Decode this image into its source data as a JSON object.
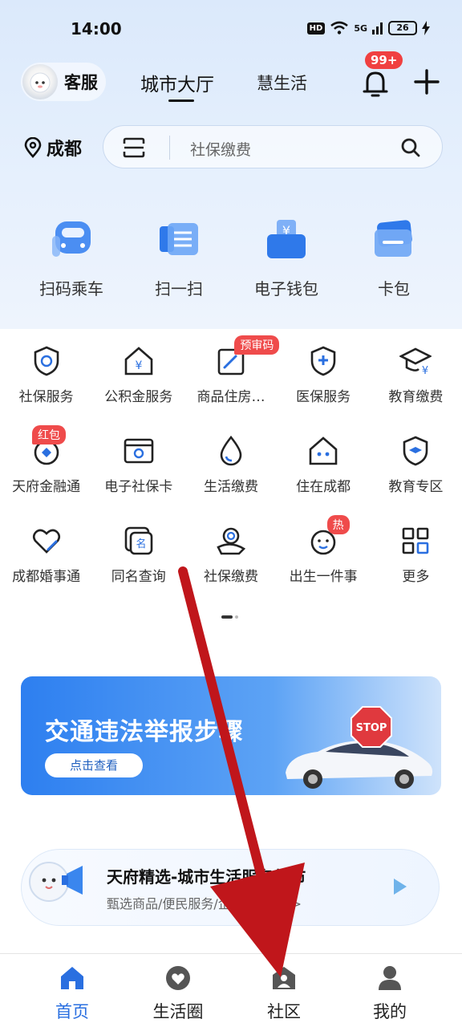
{
  "status_bar": {
    "time": "14:00",
    "hd": "HD",
    "network": "5G",
    "battery": "26"
  },
  "header": {
    "service_label": "客服",
    "tabs": [
      {
        "label": "城市大厅"
      },
      {
        "label": "慧生活"
      }
    ],
    "notification_badge": "99+"
  },
  "location": {
    "city": "成都"
  },
  "search": {
    "placeholder": "社保缴费"
  },
  "quick_actions": [
    {
      "label": "扫码乘车",
      "icon": "bus-qr-icon"
    },
    {
      "label": "扫一扫",
      "icon": "scan-icon"
    },
    {
      "label": "电子钱包",
      "icon": "wallet-icon"
    },
    {
      "label": "卡包",
      "icon": "card-icon"
    }
  ],
  "services": [
    [
      {
        "label": "社保服务",
        "icon": "social-security-shield-icon"
      },
      {
        "label": "公积金服务",
        "icon": "housing-fund-icon"
      },
      {
        "label": "商品住房…",
        "icon": "house-edit-icon",
        "tag": "预审码"
      },
      {
        "label": "医保服务",
        "icon": "medical-shield-icon"
      },
      {
        "label": "教育缴费",
        "icon": "graduation-cap-icon"
      }
    ],
    [
      {
        "label": "天府金融通",
        "icon": "finance-icon",
        "tag": "红包"
      },
      {
        "label": "电子社保卡",
        "icon": "social-card-icon"
      },
      {
        "label": "生活缴费",
        "icon": "water-drop-icon"
      },
      {
        "label": "住在成都",
        "icon": "panda-house-icon"
      },
      {
        "label": "教育专区",
        "icon": "education-shield-icon"
      }
    ],
    [
      {
        "label": "成都婚事通",
        "icon": "heart-icon"
      },
      {
        "label": "同名查询",
        "icon": "name-query-icon"
      },
      {
        "label": "社保缴费",
        "icon": "social-pay-icon"
      },
      {
        "label": "出生一件事",
        "icon": "baby-icon",
        "tag": "热"
      },
      {
        "label": "更多",
        "icon": "grid-more-icon"
      }
    ]
  ],
  "banner": {
    "title": "交通违法举报步骤",
    "button": "点击查看",
    "sign": "STOP"
  },
  "promo": {
    "title": "天府精选-城市生活服务超市",
    "subtitle": "甄选商品/便民服务/企业合作>>>"
  },
  "bottom_nav": [
    {
      "label": "首页",
      "active": true
    },
    {
      "label": "生活圈",
      "active": false
    },
    {
      "label": "社区",
      "active": false
    },
    {
      "label": "我的",
      "active": false
    }
  ],
  "colors": {
    "accent": "#2a6fe0",
    "badge": "#f04040",
    "banner": "#2d7ff0",
    "arrow": "#c0161b"
  }
}
